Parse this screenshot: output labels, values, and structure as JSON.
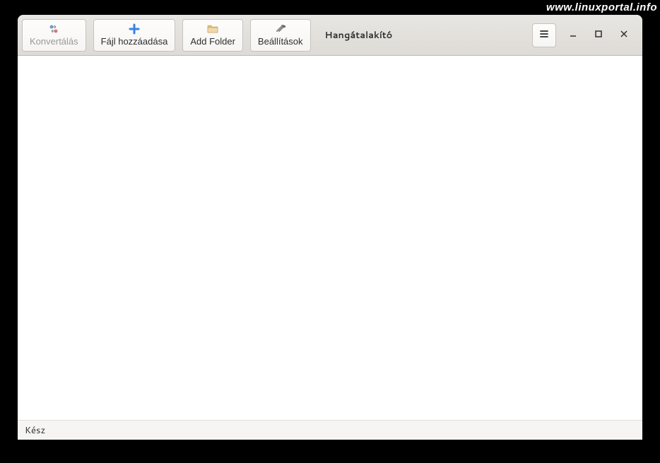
{
  "watermark": "www.linuxportal.info",
  "header": {
    "title": "Hangátalakító"
  },
  "toolbar": {
    "convert": {
      "label": "Konvertálás",
      "icon": "convert-icon"
    },
    "add_file": {
      "label": "Fájl hozzáadása",
      "icon": "add-icon"
    },
    "add_folder": {
      "label": "Add Folder",
      "icon": "folder-icon"
    },
    "settings": {
      "label": "Beállítások",
      "icon": "settings-icon"
    }
  },
  "status": {
    "text": "Kész"
  }
}
